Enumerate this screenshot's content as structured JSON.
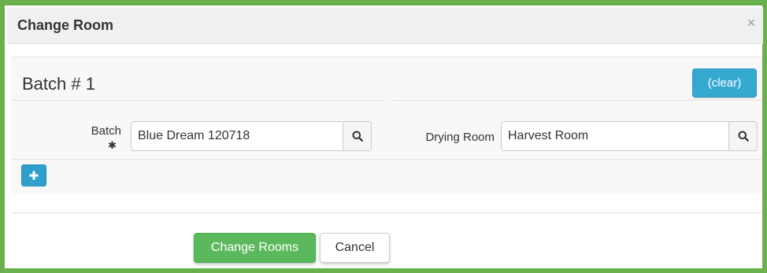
{
  "dialog": {
    "title": "Change Room",
    "close_symbol": "×"
  },
  "batch_section": {
    "title": "Batch # 1",
    "clear_label": "(clear)",
    "batch_field": {
      "label": "Batch",
      "required_symbol": "✱",
      "value": "Blue Dream 120718",
      "search_icon": "search-icon"
    },
    "room_field": {
      "label": "Drying Room",
      "value": "Harvest Room",
      "search_icon": "search-icon"
    },
    "add_icon": "plus-icon"
  },
  "footer": {
    "submit_label": "Change Rooms",
    "cancel_label": "Cancel"
  },
  "colors": {
    "frame_border": "#6ab04c",
    "primary_green": "#5cb85c",
    "info_blue": "#35a9d0"
  }
}
